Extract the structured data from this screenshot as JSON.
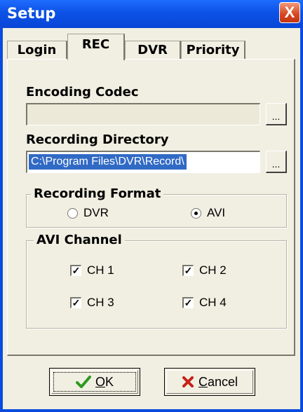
{
  "window": {
    "title": "Setup",
    "close_glyph": "X"
  },
  "tabs": [
    {
      "label": "Login",
      "active": false
    },
    {
      "label": "REC",
      "active": true
    },
    {
      "label": "DVR",
      "active": false
    },
    {
      "label": "Priority",
      "active": false
    }
  ],
  "encoding": {
    "label": "Encoding Codec",
    "value": "",
    "browse": "..."
  },
  "directory": {
    "label": "Recording Directory",
    "value": "C:\\Program Files\\DVR\\Record\\",
    "browse": "..."
  },
  "format": {
    "title": "Recording Format",
    "options": [
      {
        "label": "DVR",
        "checked": false
      },
      {
        "label": "AVI",
        "checked": true
      }
    ]
  },
  "avi": {
    "title": "AVI Channel",
    "channels": [
      {
        "label": "CH 1",
        "checked": true
      },
      {
        "label": "CH 2",
        "checked": true
      },
      {
        "label": "CH 3",
        "checked": true
      },
      {
        "label": "CH 4",
        "checked": true
      }
    ]
  },
  "buttons": {
    "ok": {
      "label_first": "O",
      "label_rest": "K",
      "icon": "checkmark-icon",
      "icon_color": "#2a9a1f"
    },
    "cancel": {
      "label_first": "C",
      "label_rest": "ancel",
      "icon": "red-x-icon",
      "icon_color": "#c4221a"
    }
  }
}
